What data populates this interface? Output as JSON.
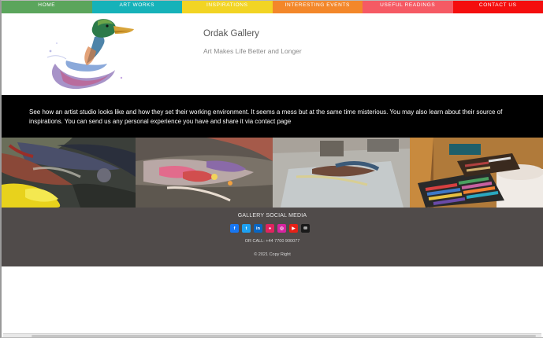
{
  "nav": {
    "items": [
      {
        "label": "HOME",
        "color": "#5ba55c"
      },
      {
        "label": "ART WORKS",
        "color": "#16b2b9"
      },
      {
        "label": "INSPIRATIONS",
        "color": "#f2d424"
      },
      {
        "label": "INTERESTING EVENTS",
        "color": "#f3872a"
      },
      {
        "label": "USEFUL READINGS",
        "color": "#f55a64"
      },
      {
        "label": "CONTACT US",
        "color": "#f40e0e"
      }
    ]
  },
  "header": {
    "title": "Ordak Gallery",
    "tagline": "Art Makes Life Better and Longer",
    "logo_icon": "duck-logo-icon"
  },
  "band": {
    "text": "See how an artist studio looks like and how they set their working environment. It seems a mess but at the same time misterious. You may also learn about their source of inspirations. You can send us any personal experience you have and share it via",
    "link": "contact page"
  },
  "gallery": {
    "photos": [
      "paint-palette-photo",
      "brush-mixing-photo",
      "glass-palette-photo",
      "oil-pastels-photo"
    ]
  },
  "footer": {
    "social_heading": "GALLERY SOCIAL MEDIA",
    "social": [
      {
        "icon": "facebook-icon",
        "glyph": "f",
        "color": "#1877f2"
      },
      {
        "icon": "twitter-icon",
        "glyph": "t",
        "color": "#1da1f2"
      },
      {
        "icon": "linkedin-icon",
        "glyph": "in",
        "color": "#0a66c2"
      },
      {
        "icon": "flickr-icon",
        "glyph": "●",
        "color": "#e0245e"
      },
      {
        "icon": "instagram-icon",
        "glyph": "◎",
        "color": "#d6249f"
      },
      {
        "icon": "youtube-icon",
        "glyph": "▶",
        "color": "#e62117"
      },
      {
        "icon": "email-icon",
        "glyph": "✉",
        "color": "#1a1a1a"
      }
    ],
    "call": "OR CALL: +44 7700 900077",
    "copyright": "© 2021 Copy Right"
  }
}
